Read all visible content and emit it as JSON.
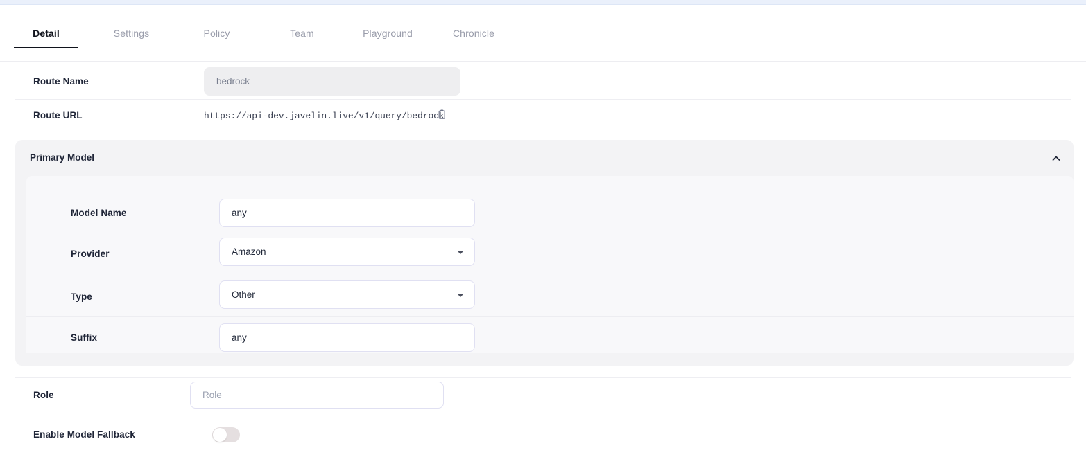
{
  "tabs": [
    {
      "label": "Detail",
      "active": true
    },
    {
      "label": "Settings",
      "active": false
    },
    {
      "label": "Policy",
      "active": false
    },
    {
      "label": "Team",
      "active": false
    },
    {
      "label": "Playground",
      "active": false
    },
    {
      "label": "Chronicle",
      "active": false
    }
  ],
  "route": {
    "name_label": "Route Name",
    "name_value": "bedrock",
    "url_label": "Route URL",
    "url_value": "https://api-dev.javelin.live/v1/query/bedrock",
    "copy_icon": "copy-icon"
  },
  "primary_model": {
    "title": "Primary Model",
    "collapse_icon": "chevron-up-icon",
    "fields": [
      {
        "label": "Model Name",
        "value": "any",
        "type": "text"
      },
      {
        "label": "Provider",
        "value": "Amazon",
        "type": "select"
      },
      {
        "label": "Type",
        "value": "Other",
        "type": "select"
      },
      {
        "label": "Suffix",
        "value": "any",
        "type": "text"
      }
    ]
  },
  "role": {
    "label": "Role",
    "value": "",
    "placeholder": "Role"
  },
  "fallback": {
    "label": "Enable Model Fallback",
    "enabled": false
  },
  "colors": {
    "accent_strip": "#eaf0fb",
    "active_tab": "#10131c",
    "inactive_tab": "#9a9dab",
    "label": "#1f2537",
    "input_border": "#e0e0f2",
    "disabled_field": "#eeeef0",
    "panel_outer": "#f3f3f5",
    "panel_inner": "#f8f8fa",
    "toggle_track_off": "#e5dfe0"
  }
}
